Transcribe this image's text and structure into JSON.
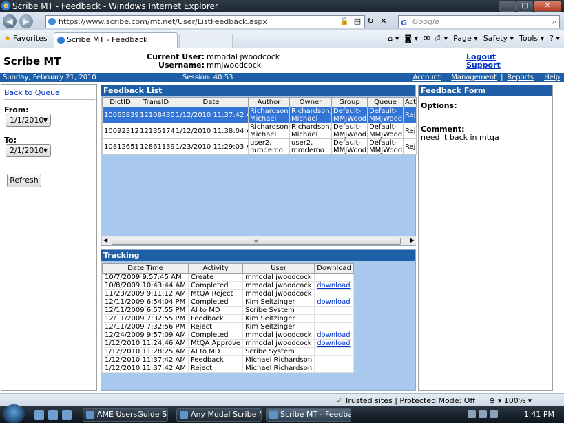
{
  "window": {
    "title": "Scribe MT - Feedback - Windows Internet Explorer"
  },
  "browser": {
    "url": "https://www.scribe.com/mt.net/User/ListFeedback.aspx",
    "search_placeholder": "Google",
    "favorites_label": "Favorites",
    "tab_title": "Scribe MT - Feedback",
    "commands": {
      "page": "Page ▾",
      "safety": "Safety ▾",
      "tools": "Tools ▾"
    }
  },
  "header": {
    "brand": "Scribe MT",
    "current_user_label": "Current User:",
    "current_user": "mmodal jwoodcock",
    "username_label": "Username:",
    "username": "mmjwoodcock",
    "logout": "Logout",
    "support": "Support"
  },
  "statusband": {
    "date": "Sunday, February 21, 2010",
    "session": "Session: 40:53",
    "nav": {
      "account": "Account",
      "management": "Management",
      "reports": "Reports",
      "help": "Help"
    }
  },
  "left": {
    "back_to_queue": "Back to Queue",
    "from_label": "From:",
    "from_value": "1/1/2010",
    "to_label": "To:",
    "to_value": "2/1/2010",
    "refresh": "Refresh"
  },
  "feedback_list": {
    "title": "Feedback List",
    "columns": [
      "DictID",
      "TransID",
      "Date",
      "Author",
      "Owner",
      "Group",
      "Queue",
      "Acti"
    ],
    "rows": [
      {
        "dictid": "10065839",
        "transid": "12108435",
        "date": "1/12/2010 11:37:42 AM",
        "author1": "Richardson,",
        "author2": "Michael",
        "owner1": "Richardson,",
        "owner2": "Michael",
        "group1": "Default-",
        "group2": "MMJWood",
        "queue1": "Default-",
        "queue2": "MMJWood",
        "action": "Rej"
      },
      {
        "dictid": "10092312",
        "transid": "12135174",
        "date": "1/12/2010 11:38:04 AM",
        "author1": "Richardson,",
        "author2": "Michael",
        "owner1": "Richardson,",
        "owner2": "Michael",
        "group1": "Default-",
        "group2": "MMJWood",
        "queue1": "Default-",
        "queue2": "MMJWood",
        "action": "Rej"
      },
      {
        "dictid": "10812651",
        "transid": "12861139",
        "date": "1/23/2010 11:29:03 AM",
        "author1": "user2,",
        "author2": "mmdemo",
        "owner1": "user2,",
        "owner2": "mmdemo",
        "group1": "Default-",
        "group2": "MMJWood",
        "queue1": "Default-",
        "queue2": "MMJWood",
        "action": "Rej"
      }
    ]
  },
  "tracking": {
    "title": "Tracking",
    "columns": [
      "Date Time",
      "Activity",
      "User",
      "Download"
    ],
    "rows": [
      {
        "datetime": "10/7/2009 9:57:45 AM",
        "activity": "Create",
        "user": "mmodal jwoodcock",
        "download": ""
      },
      {
        "datetime": "10/8/2009 10:43:44 AM",
        "activity": "Completed",
        "user": "mmodal jwoodcock",
        "download": "download"
      },
      {
        "datetime": "11/23/2009 9:11:12 AM",
        "activity": "MtQA Reject",
        "user": "mmodal jwoodcock",
        "download": ""
      },
      {
        "datetime": "12/11/2009 6:54:04 PM",
        "activity": "Completed",
        "user": "Kim Seitzinger",
        "download": "download"
      },
      {
        "datetime": "12/11/2009 6:57:55 PM",
        "activity": "AI to MD",
        "user": "Scribe System",
        "download": ""
      },
      {
        "datetime": "12/11/2009 7:32:55 PM",
        "activity": "Feedback",
        "user": "Kim Seitzinger",
        "download": ""
      },
      {
        "datetime": "12/11/2009 7:32:56 PM",
        "activity": "Reject",
        "user": "Kim Seitzinger",
        "download": ""
      },
      {
        "datetime": "12/24/2009 9:57:09 AM",
        "activity": "Completed",
        "user": "mmodal jwoodcock",
        "download": "download"
      },
      {
        "datetime": "1/12/2010 11:24:46 AM",
        "activity": "MtQA Approve",
        "user": "mmodal jwoodcock",
        "download": "download"
      },
      {
        "datetime": "1/12/2010 11:28:25 AM",
        "activity": "AI to MD",
        "user": "Scribe System",
        "download": ""
      },
      {
        "datetime": "1/12/2010 11:37:42 AM",
        "activity": "Feedback",
        "user": "Michael Richardson",
        "download": ""
      },
      {
        "datetime": "1/12/2010 11:37:42 AM",
        "activity": "Reject",
        "user": "Michael Richardson",
        "download": ""
      }
    ]
  },
  "feedback_form": {
    "title": "Feedback Form",
    "options_label": "Options:",
    "comment_label": "Comment:",
    "comment_text": "need it back in mtqa"
  },
  "statusbar": {
    "trusted": "Trusted sites | Protected Mode: Off",
    "zoom": "100%"
  },
  "taskbar": {
    "tasks": [
      "AME UsersGuide Scr...",
      "Any Modal Scribe M...",
      "Scribe MT - Feedba..."
    ],
    "clock": "1:41 PM"
  },
  "icons": {
    "back": "back-arrow-icon",
    "forward": "forward-arrow-icon",
    "lock": "lock-icon",
    "refresh": "refresh-icon",
    "stop": "stop-icon",
    "search": "search-icon"
  }
}
